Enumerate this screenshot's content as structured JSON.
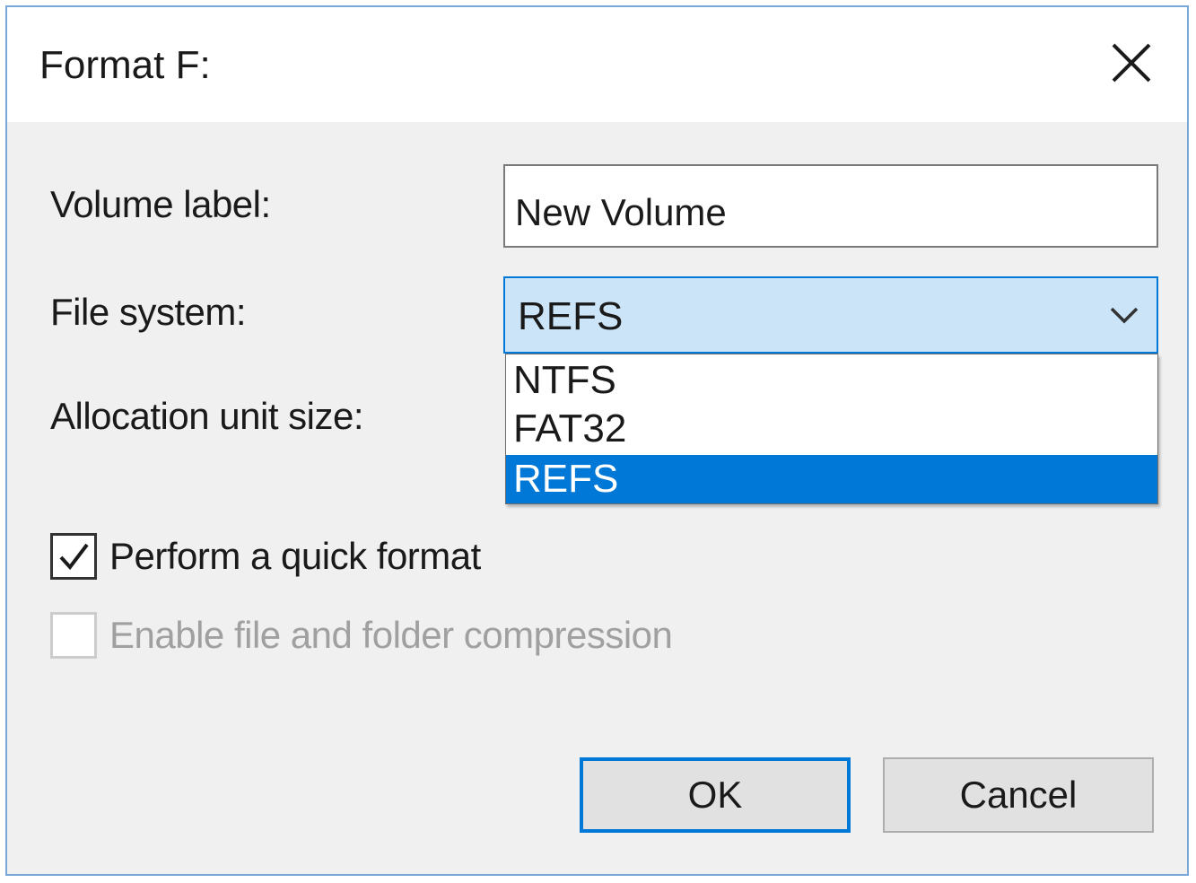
{
  "dialog": {
    "title": "Format F:",
    "close_icon": "close-icon"
  },
  "form": {
    "volume_label": {
      "label": "Volume label:",
      "value": "New Volume"
    },
    "file_system": {
      "label": "File system:",
      "selected": "REFS",
      "options": [
        "NTFS",
        "FAT32",
        "REFS"
      ],
      "highlighted_index": 2
    },
    "allocation_unit_size": {
      "label": "Allocation unit size:"
    },
    "quick_format": {
      "label": "Perform a quick format",
      "checked": true
    },
    "compression": {
      "label": "Enable file and folder compression",
      "checked": false,
      "disabled": true
    }
  },
  "buttons": {
    "ok_label": "OK",
    "cancel_label": "Cancel"
  },
  "colors": {
    "accent": "#0078d7",
    "combo_background": "#cce4f7",
    "dialog_background": "#f0f0f0",
    "window_border": "#7aa7d9"
  }
}
